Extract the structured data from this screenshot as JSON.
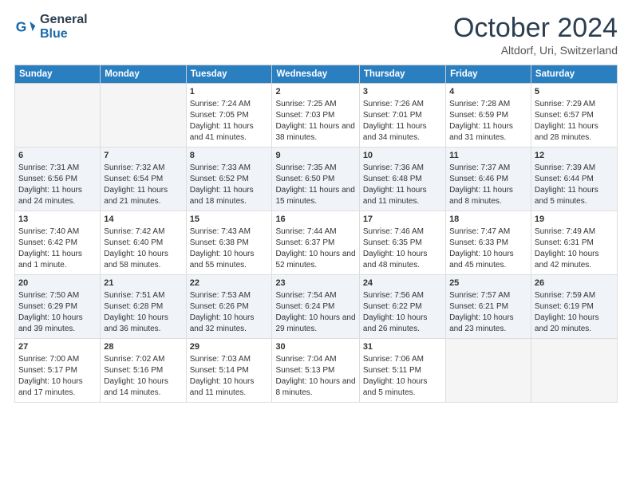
{
  "header": {
    "logo_line1": "General",
    "logo_line2": "Blue",
    "month": "October 2024",
    "location": "Altdorf, Uri, Switzerland"
  },
  "weekdays": [
    "Sunday",
    "Monday",
    "Tuesday",
    "Wednesday",
    "Thursday",
    "Friday",
    "Saturday"
  ],
  "rows": [
    [
      {
        "day": "",
        "info": ""
      },
      {
        "day": "",
        "info": ""
      },
      {
        "day": "1",
        "info": "Sunrise: 7:24 AM\nSunset: 7:05 PM\nDaylight: 11 hours and 41 minutes."
      },
      {
        "day": "2",
        "info": "Sunrise: 7:25 AM\nSunset: 7:03 PM\nDaylight: 11 hours and 38 minutes."
      },
      {
        "day": "3",
        "info": "Sunrise: 7:26 AM\nSunset: 7:01 PM\nDaylight: 11 hours and 34 minutes."
      },
      {
        "day": "4",
        "info": "Sunrise: 7:28 AM\nSunset: 6:59 PM\nDaylight: 11 hours and 31 minutes."
      },
      {
        "day": "5",
        "info": "Sunrise: 7:29 AM\nSunset: 6:57 PM\nDaylight: 11 hours and 28 minutes."
      }
    ],
    [
      {
        "day": "6",
        "info": "Sunrise: 7:31 AM\nSunset: 6:56 PM\nDaylight: 11 hours and 24 minutes."
      },
      {
        "day": "7",
        "info": "Sunrise: 7:32 AM\nSunset: 6:54 PM\nDaylight: 11 hours and 21 minutes."
      },
      {
        "day": "8",
        "info": "Sunrise: 7:33 AM\nSunset: 6:52 PM\nDaylight: 11 hours and 18 minutes."
      },
      {
        "day": "9",
        "info": "Sunrise: 7:35 AM\nSunset: 6:50 PM\nDaylight: 11 hours and 15 minutes."
      },
      {
        "day": "10",
        "info": "Sunrise: 7:36 AM\nSunset: 6:48 PM\nDaylight: 11 hours and 11 minutes."
      },
      {
        "day": "11",
        "info": "Sunrise: 7:37 AM\nSunset: 6:46 PM\nDaylight: 11 hours and 8 minutes."
      },
      {
        "day": "12",
        "info": "Sunrise: 7:39 AM\nSunset: 6:44 PM\nDaylight: 11 hours and 5 minutes."
      }
    ],
    [
      {
        "day": "13",
        "info": "Sunrise: 7:40 AM\nSunset: 6:42 PM\nDaylight: 11 hours and 1 minute."
      },
      {
        "day": "14",
        "info": "Sunrise: 7:42 AM\nSunset: 6:40 PM\nDaylight: 10 hours and 58 minutes."
      },
      {
        "day": "15",
        "info": "Sunrise: 7:43 AM\nSunset: 6:38 PM\nDaylight: 10 hours and 55 minutes."
      },
      {
        "day": "16",
        "info": "Sunrise: 7:44 AM\nSunset: 6:37 PM\nDaylight: 10 hours and 52 minutes."
      },
      {
        "day": "17",
        "info": "Sunrise: 7:46 AM\nSunset: 6:35 PM\nDaylight: 10 hours and 48 minutes."
      },
      {
        "day": "18",
        "info": "Sunrise: 7:47 AM\nSunset: 6:33 PM\nDaylight: 10 hours and 45 minutes."
      },
      {
        "day": "19",
        "info": "Sunrise: 7:49 AM\nSunset: 6:31 PM\nDaylight: 10 hours and 42 minutes."
      }
    ],
    [
      {
        "day": "20",
        "info": "Sunrise: 7:50 AM\nSunset: 6:29 PM\nDaylight: 10 hours and 39 minutes."
      },
      {
        "day": "21",
        "info": "Sunrise: 7:51 AM\nSunset: 6:28 PM\nDaylight: 10 hours and 36 minutes."
      },
      {
        "day": "22",
        "info": "Sunrise: 7:53 AM\nSunset: 6:26 PM\nDaylight: 10 hours and 32 minutes."
      },
      {
        "day": "23",
        "info": "Sunrise: 7:54 AM\nSunset: 6:24 PM\nDaylight: 10 hours and 29 minutes."
      },
      {
        "day": "24",
        "info": "Sunrise: 7:56 AM\nSunset: 6:22 PM\nDaylight: 10 hours and 26 minutes."
      },
      {
        "day": "25",
        "info": "Sunrise: 7:57 AM\nSunset: 6:21 PM\nDaylight: 10 hours and 23 minutes."
      },
      {
        "day": "26",
        "info": "Sunrise: 7:59 AM\nSunset: 6:19 PM\nDaylight: 10 hours and 20 minutes."
      }
    ],
    [
      {
        "day": "27",
        "info": "Sunrise: 7:00 AM\nSunset: 5:17 PM\nDaylight: 10 hours and 17 minutes."
      },
      {
        "day": "28",
        "info": "Sunrise: 7:02 AM\nSunset: 5:16 PM\nDaylight: 10 hours and 14 minutes."
      },
      {
        "day": "29",
        "info": "Sunrise: 7:03 AM\nSunset: 5:14 PM\nDaylight: 10 hours and 11 minutes."
      },
      {
        "day": "30",
        "info": "Sunrise: 7:04 AM\nSunset: 5:13 PM\nDaylight: 10 hours and 8 minutes."
      },
      {
        "day": "31",
        "info": "Sunrise: 7:06 AM\nSunset: 5:11 PM\nDaylight: 10 hours and 5 minutes."
      },
      {
        "day": "",
        "info": ""
      },
      {
        "day": "",
        "info": ""
      }
    ]
  ]
}
